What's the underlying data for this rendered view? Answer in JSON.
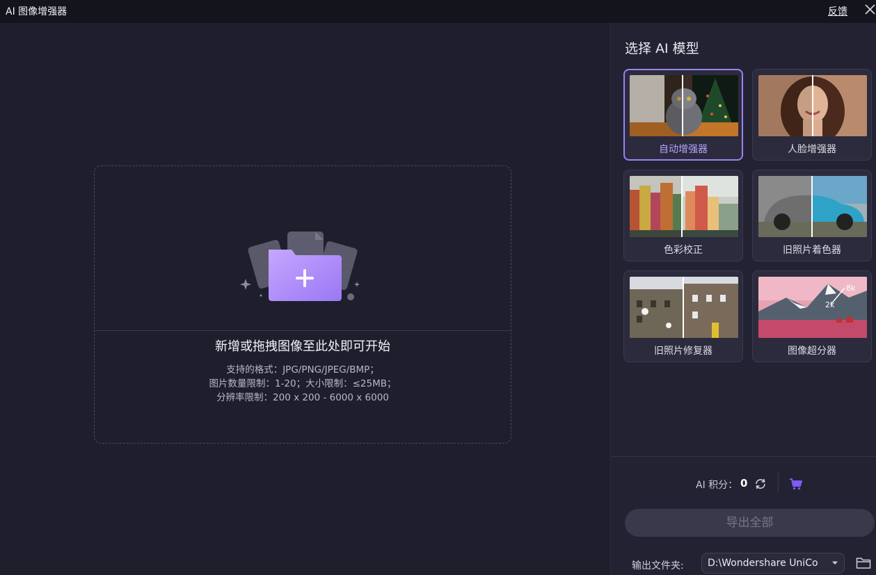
{
  "titlebar": {
    "title": "AI 图像增强器",
    "feedback": "反馈"
  },
  "dropzone": {
    "title": "新增或拖拽图像至此处即可开始",
    "formats": "支持的格式：JPG/PNG/JPEG/BMP；",
    "limits": "图片数量限制：1-20；大小限制：≤25MB；",
    "resolution": "分辨率限制：200 x 200 - 6000 x 6000"
  },
  "panel": {
    "title": "选择 AI 模型",
    "models": [
      {
        "label": "自动增强器",
        "selected": true
      },
      {
        "label": "人脸增强器"
      },
      {
        "label": "色彩校正"
      },
      {
        "label": "旧照片着色器"
      },
      {
        "label": "旧照片修复器"
      },
      {
        "label": "图像超分器"
      }
    ],
    "upscale_labels": {
      "low": "2k",
      "high": "8k"
    },
    "credits_label": "AI 积分：",
    "credits_value": "0",
    "export_label": "导出全部",
    "output_label": "输出文件夹:",
    "output_path": "D:\\Wondershare UniCo"
  },
  "colors": {
    "accent": "#9c82f5",
    "cart": "#7c5cf5",
    "background": "#1f1e2d"
  }
}
